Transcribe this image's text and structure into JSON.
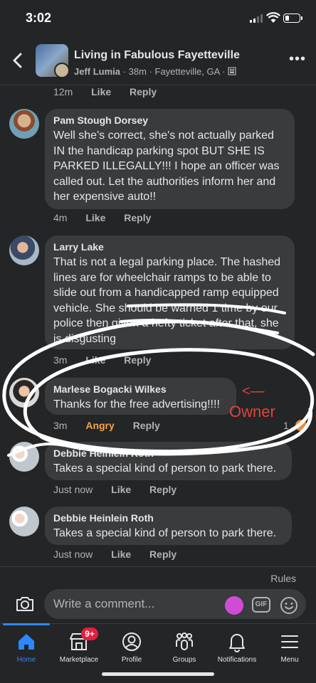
{
  "status_bar": {
    "time": "3:02"
  },
  "header": {
    "title": "Living in Fabulous Fayetteville",
    "author": "Jeff Lumia",
    "time": "38m",
    "location": "Fayetteville, GA",
    "sep": "·",
    "more": "•••"
  },
  "top_meta": {
    "time": "12m",
    "like": "Like",
    "reply": "Reply"
  },
  "comments": [
    {
      "author": "Pam Stough Dorsey",
      "text": "Well she's correct, she's not actually parked IN the handicap parking spot BUT SHE IS PARKED ILLEGALLY!!! I hope an officer was called out. Let the authorities inform her and her expensive auto!!",
      "time": "4m",
      "like": "Like",
      "reply": "Reply"
    },
    {
      "author": "Larry Lake",
      "text": "That is not a legal parking place. The hashed lines are for wheelchair ramps to be able to slide out from a handicapped ramp equipped vehicle. She should be warned 1 time by our police then given a hefty ticket after that, she is disgusting",
      "time": "3m",
      "like": "Like",
      "reply": "Reply"
    },
    {
      "author": "Marlese Bogacki Wilkes",
      "text": "Thanks for the free advertising!!!!",
      "time": "3m",
      "reaction": "Angry",
      "reply": "Reply",
      "reaction_count": "1"
    },
    {
      "author": "Debbie Heinlein Roth",
      "text": "Takes a special kind of person to park there.",
      "time": "Just now",
      "like": "Like",
      "reply": "Reply"
    },
    {
      "author": "Debbie Heinlein Roth",
      "text": "Takes a special kind of person to park there.",
      "time": "Just now",
      "like": "Like",
      "reply": "Reply"
    }
  ],
  "annotation": {
    "arrow": "<—",
    "label": "Owner"
  },
  "rules": "Rules",
  "composer": {
    "placeholder": "Write a comment...",
    "gif": "GIF"
  },
  "tabs": [
    {
      "label": "Home",
      "icon": "home-icon",
      "active": true
    },
    {
      "label": "Marketplace",
      "icon": "marketplace-icon",
      "badge": "9+"
    },
    {
      "label": "Profile",
      "icon": "profile-icon"
    },
    {
      "label": "Groups",
      "icon": "groups-icon"
    },
    {
      "label": "Notifications",
      "icon": "bell-icon"
    },
    {
      "label": "Menu",
      "icon": "menu-icon"
    }
  ],
  "colors": {
    "background": "#242526",
    "bubble": "#3a3b3c",
    "accent": "#2d88ff",
    "angry": "#f7a24b",
    "annotation": "#e0443a"
  }
}
